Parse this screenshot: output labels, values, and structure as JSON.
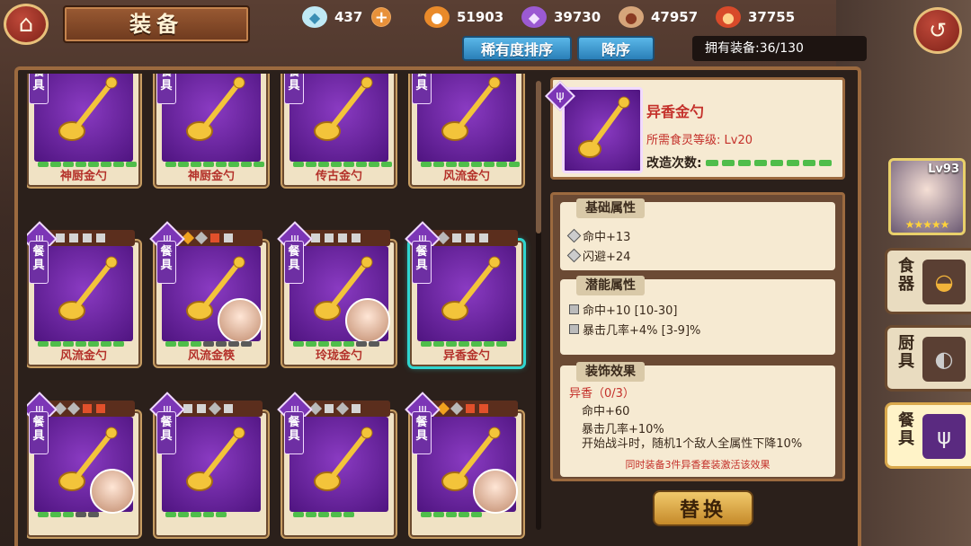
{
  "title": "装备",
  "resources": [
    {
      "icon": "diamond-icon",
      "value": "437"
    },
    {
      "icon": "potion-icon",
      "value": "51903"
    },
    {
      "icon": "crystal-icon",
      "value": "39730"
    },
    {
      "icon": "meat-icon",
      "value": "47957"
    },
    {
      "icon": "stew-icon",
      "value": "37755"
    }
  ],
  "sort": {
    "rarity_label": "稀有度排序",
    "order_label": "降序"
  },
  "owned": "拥有装备:36/130",
  "cards": [
    {
      "cat": "餐具",
      "name": "神厨金勺",
      "bars": 8,
      "on": 8
    },
    {
      "cat": "餐具",
      "name": "神厨金勺",
      "bars": 8,
      "on": 8
    },
    {
      "cat": "餐具",
      "name": "传古金勺",
      "bars": 8,
      "on": 8
    },
    {
      "cat": "餐具",
      "name": "风流金勺",
      "bars": 8,
      "on": 8
    },
    {
      "cat": "餐具",
      "name": "风流金勺",
      "bars": 7,
      "on": 7
    },
    {
      "cat": "餐具",
      "name": "风流金筷",
      "bars": 7,
      "on": 3
    },
    {
      "cat": "餐具",
      "name": "玲珑金勺",
      "bars": 7,
      "on": 5
    },
    {
      "cat": "餐具",
      "name": "异香金勺",
      "bars": 7,
      "on": 7
    },
    {
      "cat": "餐具",
      "name": "",
      "bars": 5,
      "on": 3
    },
    {
      "cat": "餐具",
      "name": "",
      "bars": 5,
      "on": 5
    },
    {
      "cat": "餐具",
      "name": "",
      "bars": 5,
      "on": 5
    },
    {
      "cat": "餐具",
      "name": "",
      "bars": 5,
      "on": 5
    }
  ],
  "detail": {
    "name": "异香金勺",
    "req_label": "所需食灵等级: ",
    "req_value": "Lv20",
    "mod_label": "改造次数:"
  },
  "base": {
    "title": "基础属性",
    "rows": [
      "命中+13",
      "闪避+24"
    ]
  },
  "potential": {
    "title": "潜能属性",
    "rows": [
      "命中+10 [10-30]",
      "暴击几率+4%  [3-9]%"
    ]
  },
  "deco": {
    "title": "装饰效果",
    "set": "异香（0/3）",
    "rows": [
      "命中+60",
      "暴击几率+10%",
      "开始战斗时，随机1个敌人全属性下降10%"
    ],
    "foot": "同时装备3件异香套装激活该效果"
  },
  "replace_label": "替换",
  "hero": {
    "level": "Lv93",
    "stars": "★★★★★"
  },
  "tabs": [
    {
      "label": "食器",
      "icon": "bowl-icon"
    },
    {
      "label": "厨具",
      "icon": "pan-icon"
    },
    {
      "label": "餐具",
      "icon": "fork-icon"
    }
  ]
}
